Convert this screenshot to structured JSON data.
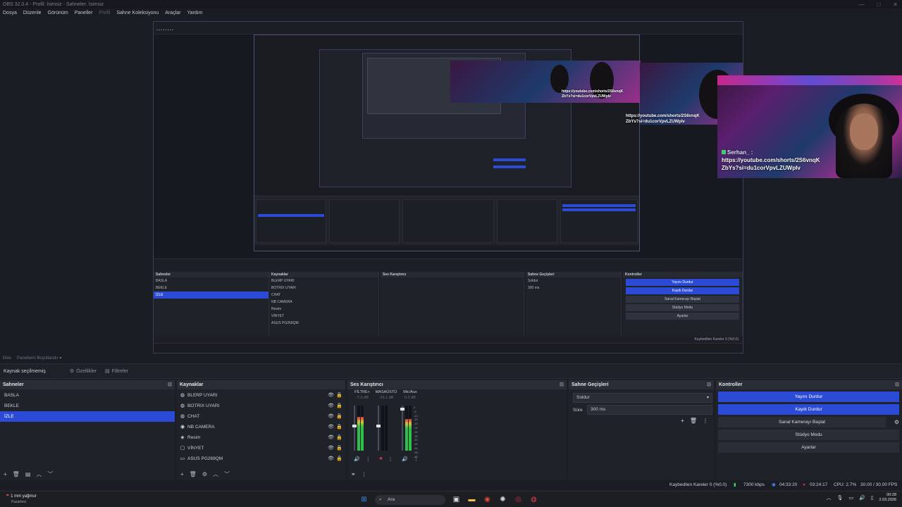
{
  "window": {
    "title": "OBS 32.0.4 - Profil: İsimsiz - Sahneler: İsimsiz",
    "controls": [
      "—",
      "□",
      "✕"
    ]
  },
  "menu": [
    "Dosya",
    "Düzenle",
    "Görünüm",
    "Paneller",
    "Profil",
    "Sahne Koleksiyonu",
    "Araçlar",
    "Yardım"
  ],
  "preview": {
    "chat": {
      "user": "Serhan_ :",
      "message_line1": "https://youtube.com/shorts/2S6vnqK",
      "message_line2": "ZbYs?si=du1corVpvLZUWpIv"
    }
  },
  "context_toolbar": {
    "label": "Kaynak seçilmemiş",
    "properties": "Özellikler",
    "filters": "Filtreler",
    "scene_label_small": "Ekle",
    "edit_label": "Panellerin Boyutlandır"
  },
  "scenes": {
    "title": "Sahneler",
    "items": [
      {
        "name": "BASLA",
        "selected": false
      },
      {
        "name": "BEKLE",
        "selected": false
      },
      {
        "name": "İZLE",
        "selected": true
      }
    ]
  },
  "sources": {
    "title": "Kaynaklar",
    "items": [
      {
        "name": "BLERP UYARI",
        "icon": "globe-icon"
      },
      {
        "name": "BOTRIX UYARI",
        "icon": "globe-icon"
      },
      {
        "name": "CHAT",
        "icon": "globe-icon"
      },
      {
        "name": "NB CAMERA",
        "icon": "camera-icon"
      },
      {
        "name": "Resim",
        "icon": "image-icon"
      },
      {
        "name": "VİNYET",
        "icon": "image-icon"
      },
      {
        "name": "ASUS PG269QM",
        "icon": "monitor-icon"
      }
    ]
  },
  "mixer": {
    "title": "Ses Karıştırıcı",
    "channels": [
      {
        "name": "FİLTRE+",
        "db": "-7.0 dB",
        "level": 0.75,
        "fader": 0.55
      },
      {
        "name": "MASAÜSTÜ",
        "db": "-15.1 dB",
        "level": 0.0,
        "fader": 0.55
      },
      {
        "name": "Mic/Aux",
        "db": "0.0 dB",
        "level": 0.7,
        "fader": 0.95
      }
    ],
    "scale": [
      "0",
      "-5",
      "-10",
      "-15",
      "-20",
      "-25",
      "-30",
      "-35",
      "-40",
      "-45",
      "-50",
      "-55",
      "-60"
    ]
  },
  "transitions": {
    "title": "Sahne Geçişleri",
    "selected": "Soldur",
    "duration_label": "Süre",
    "duration_value": "300 ms"
  },
  "controls": {
    "title": "Kontroller",
    "buttons": [
      {
        "label": "Yayını Durdur",
        "active": true
      },
      {
        "label": "Kaydı Durdur",
        "active": true
      },
      {
        "label": "Sanal Kamerayı Başlat",
        "active": false
      },
      {
        "label": "Stüdyo Modu",
        "active": false
      },
      {
        "label": "Ayarlar",
        "active": false
      }
    ]
  },
  "status_bar": {
    "dropped": "Kaybedilen Kareler 0 (%0.0)",
    "bitrate": "7300 kbps",
    "stream_time": "04:33:20",
    "rec_time": "03:24:17",
    "cpu": "CPU: 2.7%",
    "fps": "30.00 / 30.00 FPS"
  },
  "taskbar": {
    "weather_temp": "1 mm yağmur",
    "weather_sub": "Pazartesi",
    "search": "Ara",
    "time": "00:28",
    "date": "2.03.2026"
  },
  "colors": {
    "accent": "#2b4bd6",
    "panel": "#20222a",
    "background": "#1d1f26"
  }
}
